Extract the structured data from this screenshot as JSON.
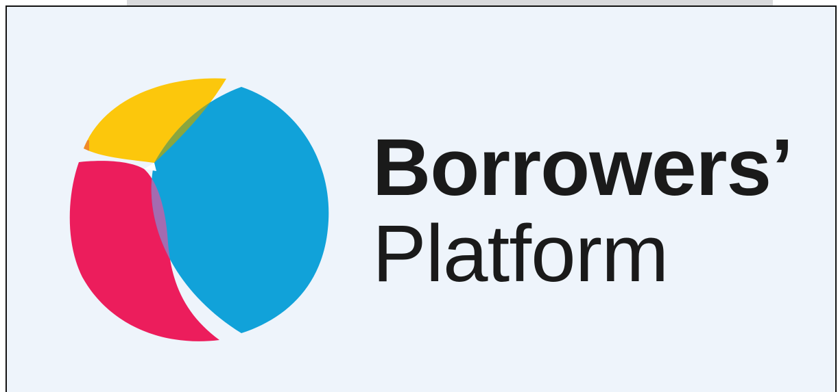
{
  "logo": {
    "line1": "Borrowers’",
    "line2": "Platform",
    "colors": {
      "yellow": "#fcc70c",
      "blue": "#11a2d9",
      "red": "#ec1d5c",
      "orange": "#f08a2a",
      "green": "#8aa63e",
      "purple": "#a46bb0",
      "text": "#1a1a1a",
      "background": "#eef4fb"
    }
  }
}
